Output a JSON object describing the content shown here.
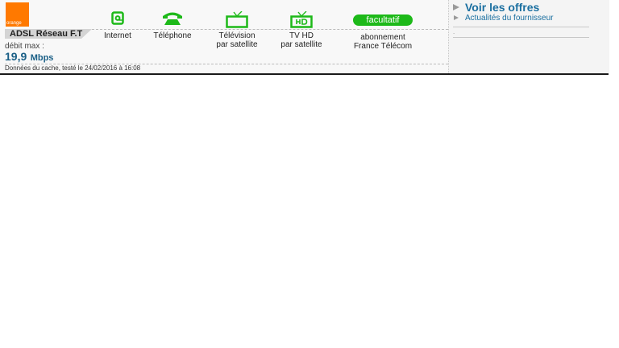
{
  "provider": {
    "logo_text": "orange",
    "brand_color": "#ff7900"
  },
  "offer": {
    "name": "ADSL Réseau F.T",
    "speed_label": "débit max :",
    "speed_value": "19,9",
    "speed_unit": "Mbps",
    "cache_note": "Données du cache, testé le 24/02/2016 à 16:08"
  },
  "services": [
    {
      "icon": "internet-at-icon",
      "label1": "Internet",
      "label2": ""
    },
    {
      "icon": "telephone-icon",
      "label1": "Téléphone",
      "label2": ""
    },
    {
      "icon": "tv-icon",
      "label1": "Télévision",
      "label2": "par satellite"
    },
    {
      "icon": "tv-hd-icon",
      "label1": "TV HD",
      "label2": "par satellite"
    },
    {
      "badge": "facultatif",
      "label1": "abonnement",
      "label2": "France Télécom"
    }
  ],
  "sidebar": {
    "offers_link": "Voir les offres",
    "news_link": "Actualités du fournisseur",
    "placeholder_dot": "."
  },
  "colors": {
    "service_green": "#1db919",
    "link_blue": "#1a6fa0",
    "speed_blue": "#1a5f86"
  }
}
